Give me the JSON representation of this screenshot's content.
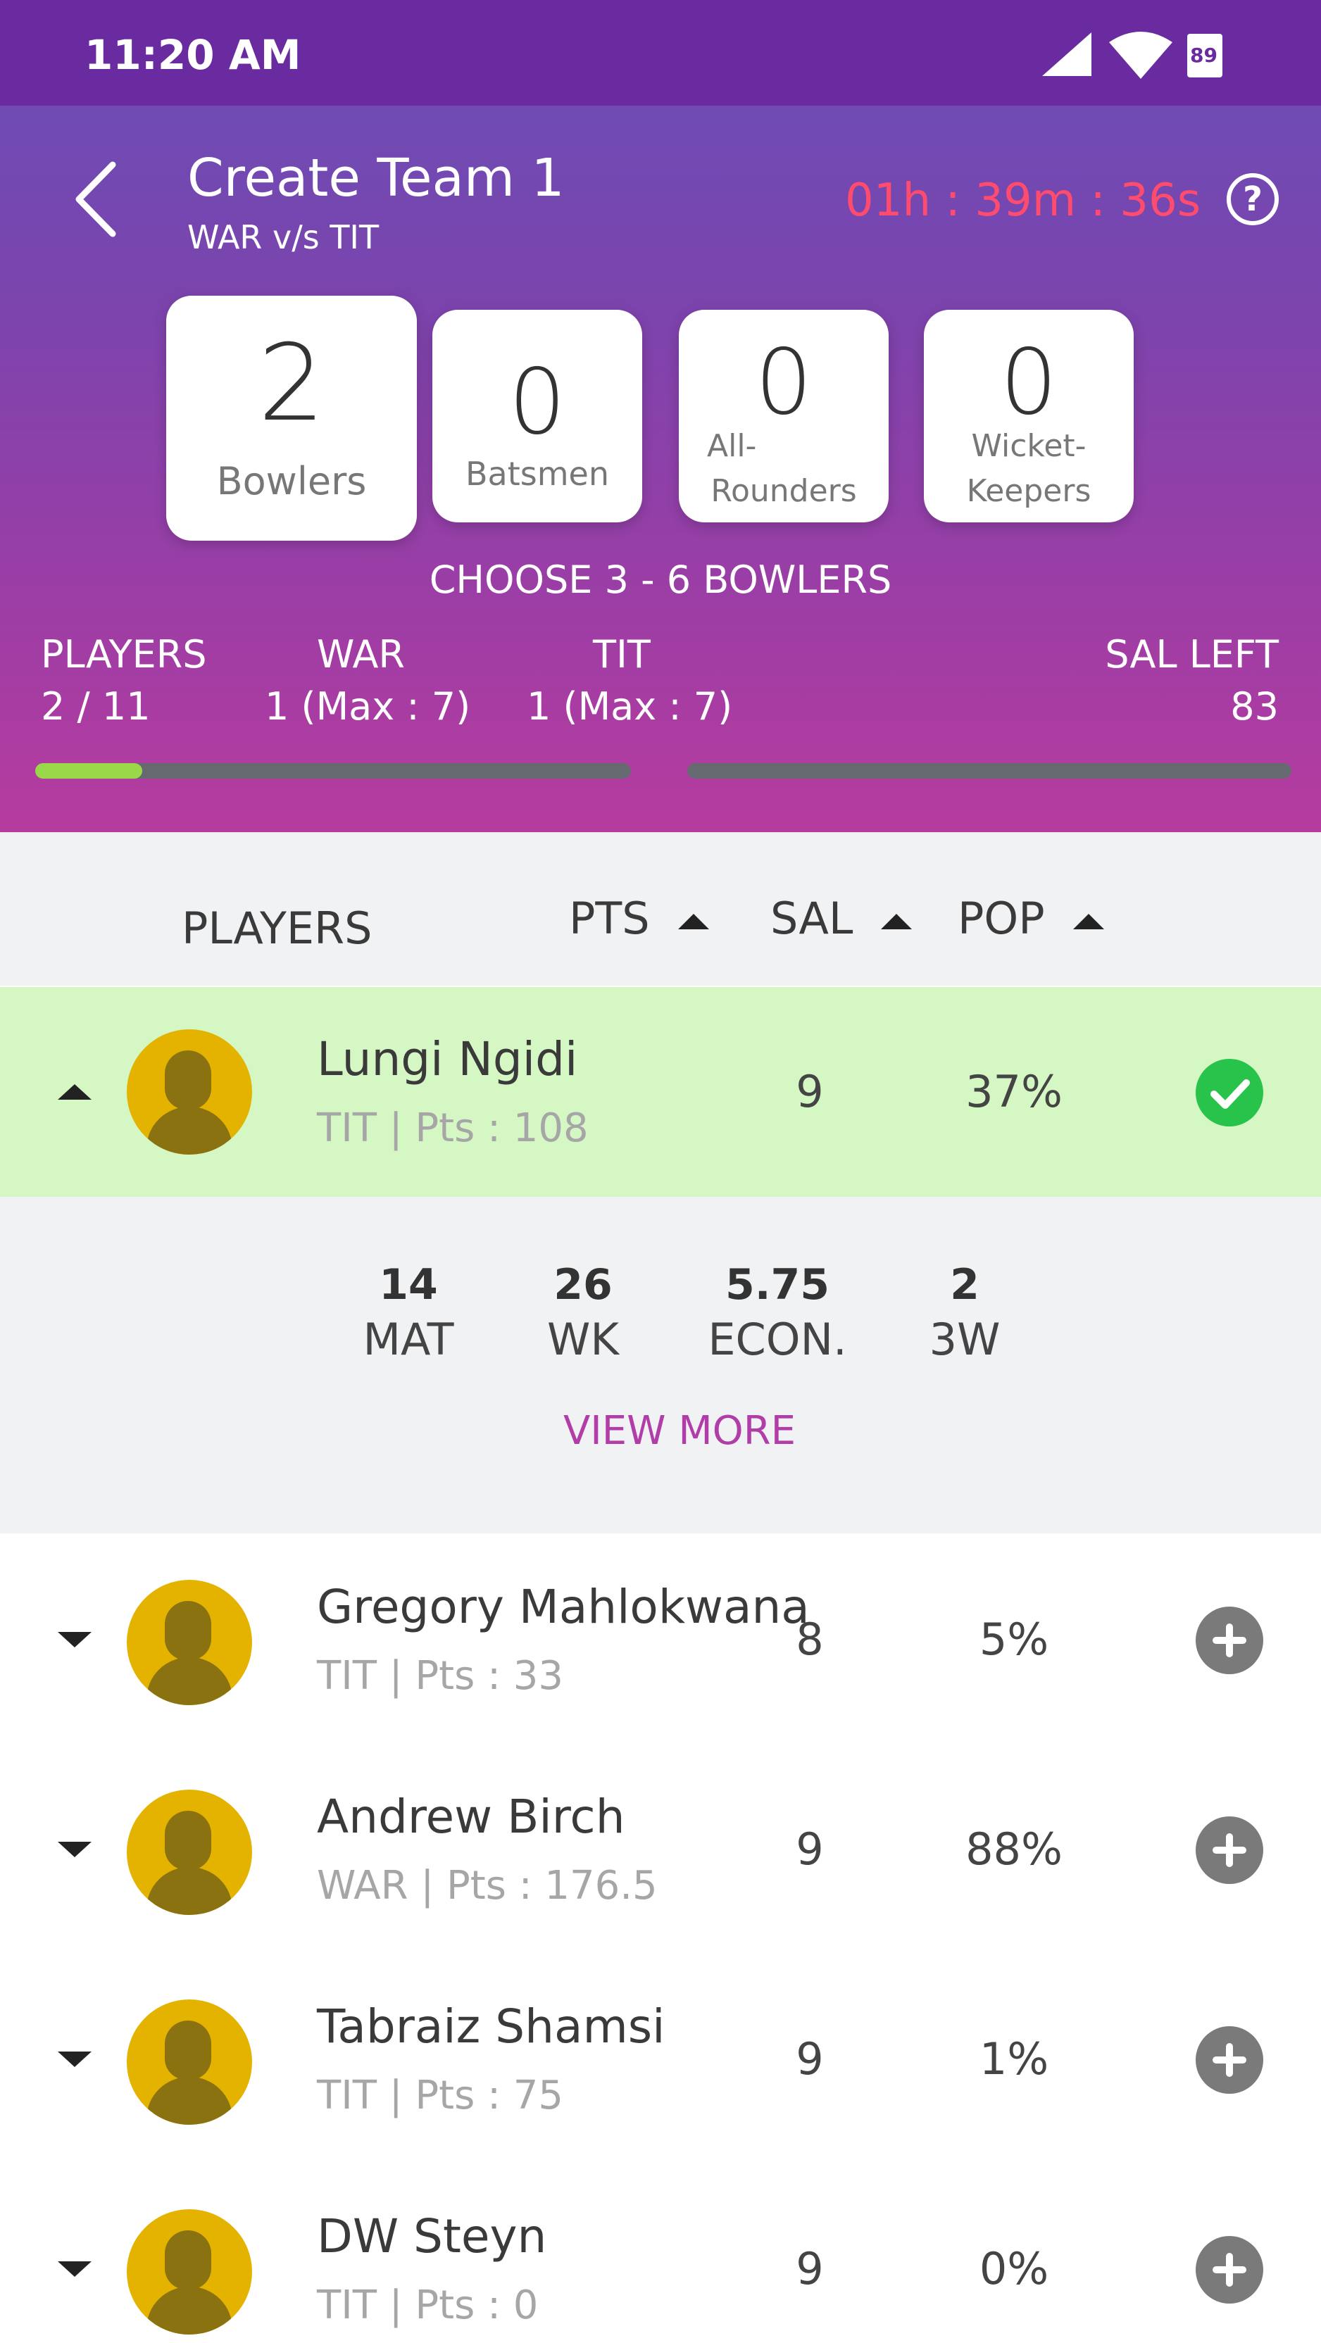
{
  "status_bar": {
    "time": "11:20 AM",
    "battery": "89"
  },
  "header": {
    "title": "Create Team 1",
    "subtitle": "WAR v/s TIT",
    "timer": "01h : 39m : 36s",
    "timer_color": "#ff4b6e"
  },
  "role_cards": [
    {
      "count": "2",
      "label": "Bowlers"
    },
    {
      "count": "0",
      "label": "Batsmen"
    },
    {
      "count": "0",
      "label_line1": "All-",
      "label_line2": "Rounders"
    },
    {
      "count": "0",
      "label_line1": "Wicket-",
      "label_line2": "Keepers"
    }
  ],
  "instruction": "CHOOSE 3 - 6 BOWLERS",
  "summary": {
    "players_label": "PLAYERS",
    "players_value": "2 / 11",
    "team1_label": "WAR",
    "team1_value": "1 (Max : 7)",
    "team2_label": "TIT",
    "team2_value": "1 (Max : 7)",
    "sal_label": "SAL LEFT",
    "sal_value": "83",
    "players_progress_fraction": 0.18
  },
  "columns": {
    "players": "PLAYERS",
    "pts": "PTS",
    "sal": "SAL",
    "pop": "POP"
  },
  "players": [
    {
      "name": "Lungi Ngidi",
      "meta": "TIT | Pts : 108",
      "sal": "9",
      "pop": "37%",
      "selected": true
    },
    {
      "name": "Gregory Mahlokwana",
      "meta": "TIT | Pts : 33",
      "sal": "8",
      "pop": "5%",
      "selected": false
    },
    {
      "name": "Andrew Birch",
      "meta": "WAR | Pts : 176.5",
      "sal": "9",
      "pop": "88%",
      "selected": false
    },
    {
      "name": "Tabraiz Shamsi",
      "meta": "TIT | Pts : 75",
      "sal": "9",
      "pop": "1%",
      "selected": false
    },
    {
      "name": "DW Steyn",
      "meta": "TIT | Pts : 0",
      "sal": "9",
      "pop": "0%",
      "selected": false
    }
  ],
  "stats": [
    {
      "value": "14",
      "label": "MAT"
    },
    {
      "value": "26",
      "label": "WK"
    },
    {
      "value": "5.75",
      "label": "ECON."
    },
    {
      "value": "2",
      "label": "3W"
    }
  ],
  "view_more": "VIEW MORE",
  "colors": {
    "accent": "#b13ea8",
    "selected_row": "#d4f7c4",
    "check": "#27c34a",
    "avatar": "#e3b300"
  }
}
